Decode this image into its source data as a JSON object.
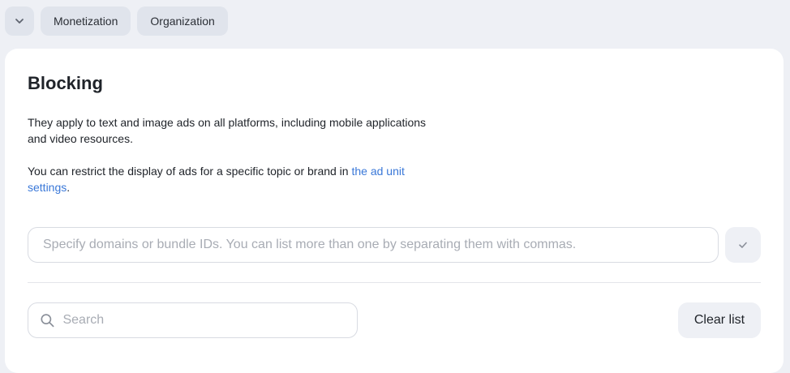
{
  "topbar": {
    "collapse_icon": "chevron-down-icon",
    "chips": [
      "Monetization",
      "Organization"
    ]
  },
  "blocking": {
    "title": "Blocking",
    "description": "They apply to text and image ads on all platforms, including mobile applications and video resources.",
    "restrict_text": "You can restrict the display of ads for a specific topic or brand in ",
    "restrict_link": "the ad unit settings",
    "restrict_end": ".",
    "domains_placeholder": "Specify domains or bundle IDs. You can list more than one by separating them with commas.",
    "domains_value": "",
    "confirm_icon": "check-icon",
    "search_icon": "search-icon",
    "search_placeholder": "Search",
    "search_value": "",
    "clear_label": "Clear list"
  }
}
